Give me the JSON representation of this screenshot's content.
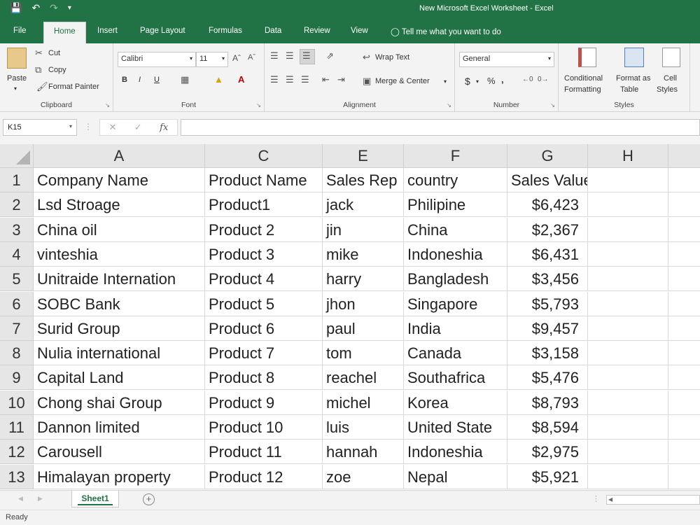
{
  "window": {
    "title": "New Microsoft Excel Worksheet  -  Excel"
  },
  "quick_access": {
    "save_icon": "save-icon",
    "undo_icon": "undo-icon",
    "redo_icon": "redo-icon"
  },
  "tabs": [
    {
      "label": "File"
    },
    {
      "label": "Home"
    },
    {
      "label": "Insert"
    },
    {
      "label": "Page Layout"
    },
    {
      "label": "Formulas"
    },
    {
      "label": "Data"
    },
    {
      "label": "Review"
    },
    {
      "label": "View"
    }
  ],
  "tell_me": "Tell me what you want to do",
  "ribbon": {
    "clipboard": {
      "paste": "Paste",
      "cut": "Cut",
      "copy": "Copy",
      "format_painter": "Format Painter",
      "label": "Clipboard"
    },
    "font": {
      "name": "Calibri",
      "size": "11",
      "bold": "B",
      "italic": "I",
      "underline": "U",
      "label": "Font"
    },
    "alignment": {
      "wrap_text": "Wrap Text",
      "merge_center": "Merge & Center",
      "label": "Alignment"
    },
    "number": {
      "format": "General",
      "currency": "$",
      "percent": "%",
      "comma": ",",
      "label": "Number"
    },
    "styles": {
      "conditional_1": "Conditional",
      "conditional_2": "Formatting",
      "format_table_1": "Format as",
      "format_table_2": "Table",
      "cell_styles_1": "Cell",
      "cell_styles_2": "Styles",
      "label": "Styles"
    }
  },
  "formula_bar": {
    "name_box": "K15",
    "fx": "fx",
    "value": ""
  },
  "columns": [
    "A",
    "C",
    "E",
    "F",
    "G",
    "H"
  ],
  "rows": [
    {
      "num": "1",
      "cells": [
        "Company Name",
        "Product Name",
        "Sales Rep",
        "country",
        "Sales Value",
        ""
      ]
    },
    {
      "num": "2",
      "cells": [
        "Lsd Stroage",
        "Product1",
        "jack",
        "Philipine",
        "$6,423",
        ""
      ]
    },
    {
      "num": "3",
      "cells": [
        "China oil",
        "Product 2",
        "jin",
        "China",
        "$2,367",
        ""
      ]
    },
    {
      "num": "4",
      "cells": [
        "vinteshia",
        "Product 3",
        "mike",
        "Indoneshia",
        "$6,431",
        ""
      ]
    },
    {
      "num": "5",
      "cells": [
        "Unitraide Internation",
        "Product 4",
        "harry",
        "Bangladesh",
        "$3,456",
        ""
      ]
    },
    {
      "num": "6",
      "cells": [
        "SOBC Bank",
        "Product 5",
        "jhon",
        "Singapore",
        "$5,793",
        ""
      ]
    },
    {
      "num": "7",
      "cells": [
        "Surid Group",
        "Product 6",
        "paul",
        "India",
        "$9,457",
        ""
      ]
    },
    {
      "num": "8",
      "cells": [
        "Nulia international",
        "Product 7",
        "tom",
        "Canada",
        "$3,158",
        ""
      ]
    },
    {
      "num": "9",
      "cells": [
        "Capital Land",
        "Product 8",
        "reachel",
        "Southafrica",
        "$5,476",
        ""
      ]
    },
    {
      "num": "10",
      "cells": [
        "Chong shai Group",
        "Product 9",
        "michel",
        "Korea",
        "$8,793",
        ""
      ]
    },
    {
      "num": "11",
      "cells": [
        "Dannon limited",
        "Product 10",
        "luis",
        "United State",
        "$8,594",
        ""
      ]
    },
    {
      "num": "12",
      "cells": [
        "Carousell",
        "Product 11",
        "hannah",
        "Indoneshia",
        "$2,975",
        ""
      ]
    },
    {
      "num": "13",
      "cells": [
        "Himalayan property",
        "Product 12",
        "zoe",
        "Nepal",
        "$5,921",
        ""
      ]
    }
  ],
  "sheets": [
    {
      "label": "Sheet1"
    }
  ],
  "status": "Ready",
  "colors": {
    "accent": "#217346"
  }
}
